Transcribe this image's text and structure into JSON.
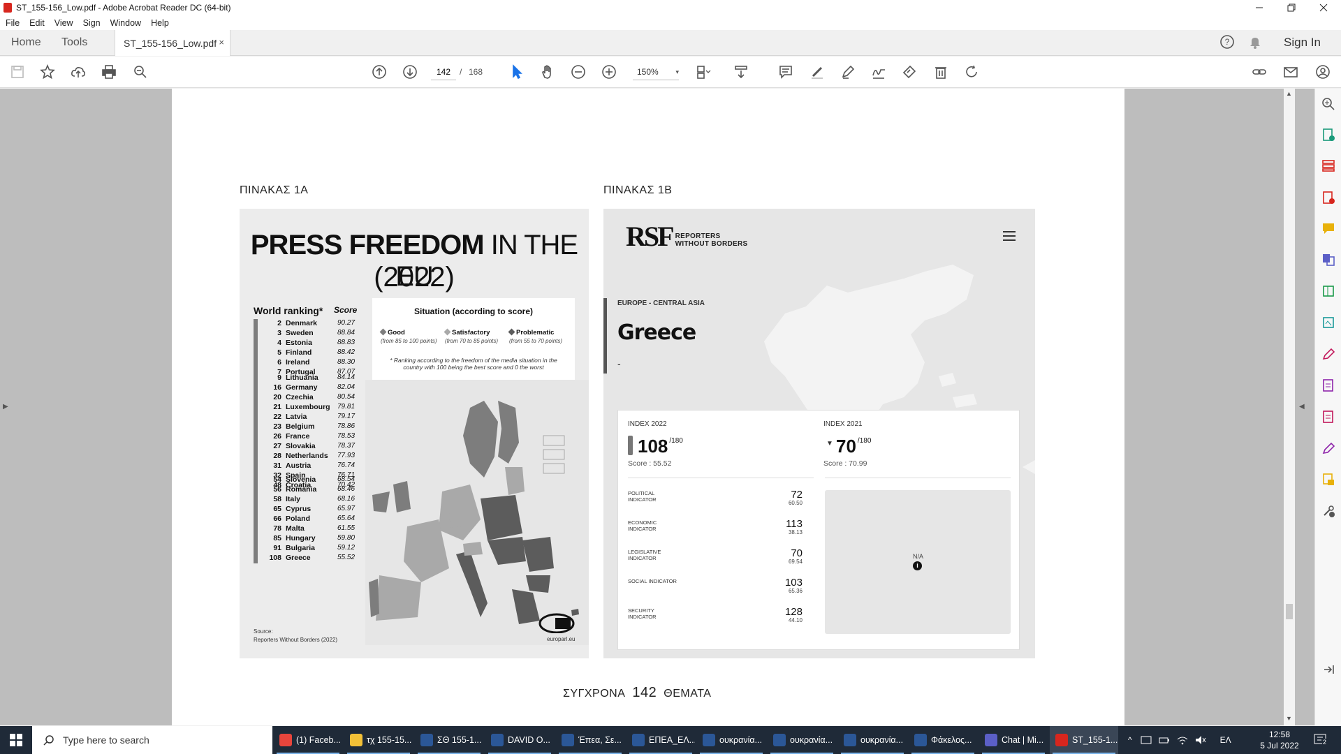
{
  "window": {
    "title": "ST_155-156_Low.pdf - Adobe Acrobat Reader DC (64-bit)",
    "minimize_icon": "minimize-icon",
    "restore_icon": "restore-icon",
    "close_icon": "close-icon"
  },
  "menu": [
    "File",
    "Edit",
    "View",
    "Sign",
    "Window",
    "Help"
  ],
  "tabs": {
    "home": "Home",
    "tools": "Tools",
    "doc": "ST_155-156_Low.pdf",
    "doc_close": "×",
    "signin": "Sign In"
  },
  "toolbar": {
    "page_current": "142",
    "page_sep": "/",
    "page_total": "168",
    "zoom": "150%",
    "zoom_chevron": "▾"
  },
  "document": {
    "label_a": "ΠΙΝΑΚΑΣ 1Α",
    "label_b": "ΠΙΝΑΚΑΣ 1Β",
    "footer_left": "ΣΥΓΧΡΟΝΑ",
    "footer_page": "142",
    "footer_right": "ΘΕΜΑΤΑ",
    "infographic_a": {
      "title_bold": "PRESS FREEDOM",
      "title_rest": " IN THE EU",
      "title_year": "(2022)",
      "ranking_header": "World ranking*",
      "score_header": "Score",
      "situation_title": "Situation (according to score)",
      "legend": [
        {
          "label": "Good",
          "range": "(from 85 to 100 points)",
          "color": "#7d7d7d"
        },
        {
          "label": "Satisfactory",
          "range": "(from 70 to 85 points)",
          "color": "#a9a9a9"
        },
        {
          "label": "Problematic",
          "range": "(from 55 to 70 points)",
          "color": "#5c5c5c"
        }
      ],
      "note": "* Ranking according to the freedom of the media situation in the country with 100 being the best score and 0 the worst",
      "groups": [
        {
          "name": "Good",
          "rows": [
            {
              "rank": "2",
              "country": "Denmark",
              "score": "90.27"
            },
            {
              "rank": "3",
              "country": "Sweden",
              "score": "88.84"
            },
            {
              "rank": "4",
              "country": "Estonia",
              "score": "88.83"
            },
            {
              "rank": "5",
              "country": "Finland",
              "score": "88.42"
            },
            {
              "rank": "6",
              "country": "Ireland",
              "score": "88.30"
            },
            {
              "rank": "7",
              "country": "Portugal",
              "score": "87.07"
            }
          ]
        },
        {
          "name": "Satisfactory",
          "rows": [
            {
              "rank": "9",
              "country": "Lithuania",
              "score": "84.14"
            },
            {
              "rank": "16",
              "country": "Germany",
              "score": "82.04"
            },
            {
              "rank": "20",
              "country": "Czechia",
              "score": "80.54"
            },
            {
              "rank": "21",
              "country": "Luxembourg",
              "score": "79.81"
            },
            {
              "rank": "22",
              "country": "Latvia",
              "score": "79.17"
            },
            {
              "rank": "23",
              "country": "Belgium",
              "score": "78.86"
            },
            {
              "rank": "26",
              "country": "France",
              "score": "78.53"
            },
            {
              "rank": "27",
              "country": "Slovakia",
              "score": "78.37"
            },
            {
              "rank": "28",
              "country": "Netherlands",
              "score": "77.93"
            },
            {
              "rank": "31",
              "country": "Austria",
              "score": "76.74"
            },
            {
              "rank": "32",
              "country": "Spain",
              "score": "76.71"
            },
            {
              "rank": "48",
              "country": "Croatia",
              "score": "70.42"
            }
          ]
        },
        {
          "name": "Problematic",
          "rows": [
            {
              "rank": "54",
              "country": "Slovenia",
              "score": "68.54"
            },
            {
              "rank": "56",
              "country": "Romania",
              "score": "68.46"
            },
            {
              "rank": "58",
              "country": "Italy",
              "score": "68.16"
            },
            {
              "rank": "65",
              "country": "Cyprus",
              "score": "65.97"
            },
            {
              "rank": "66",
              "country": "Poland",
              "score": "65.64"
            },
            {
              "rank": "78",
              "country": "Malta",
              "score": "61.55"
            },
            {
              "rank": "85",
              "country": "Hungary",
              "score": "59.80"
            },
            {
              "rank": "91",
              "country": "Bulgaria",
              "score": "59.12"
            },
            {
              "rank": "108",
              "country": "Greece",
              "score": "55.52"
            }
          ]
        }
      ],
      "source_label": "Source:",
      "source": "Reporters Without Borders (2022)",
      "credit": "europarl.eu"
    },
    "infographic_b": {
      "logo": "RSF",
      "logo_sub_1": "REPORTERS",
      "logo_sub_2": "WITHOUT BORDERS",
      "region": "EUROPE - CENTRAL ASIA",
      "country": "Greece",
      "dash": "-",
      "index_2022_label": "INDEX 2022",
      "index_2022": "108",
      "index_2022_of": "/180",
      "score_2022": "Score : 55.52",
      "index_2021_label": "INDEX 2021",
      "index_2021_arrow": "▼",
      "index_2021": "70",
      "index_2021_of": "/180",
      "score_2021": "Score : 70.99",
      "indicators": [
        {
          "label": "POLITICAL INDICATOR",
          "rank": "72",
          "score": "60.50"
        },
        {
          "label": "ECONOMIC INDICATOR",
          "rank": "113",
          "score": "38.13"
        },
        {
          "label": "LEGISLATIVE INDICATOR",
          "rank": "70",
          "score": "69.54"
        },
        {
          "label": "SOCIAL INDICATOR",
          "rank": "103",
          "score": "65.36"
        },
        {
          "label": "SECURITY INDICATOR",
          "rank": "128",
          "score": "44.10"
        }
      ],
      "map_na": "N/A",
      "map_info": "i"
    }
  },
  "taskbar": {
    "search_placeholder": "Type here to search",
    "apps": [
      {
        "label": "(1) Faceb...",
        "icon": "chrome-icon",
        "color": "#e8453c"
      },
      {
        "label": "τχ 155-15...",
        "icon": "folder-icon",
        "color": "#f2c037"
      },
      {
        "label": "ΣΘ 155-1...",
        "icon": "word-icon",
        "color": "#2b5797"
      },
      {
        "label": "DAVID O...",
        "icon": "word-icon",
        "color": "#2b5797"
      },
      {
        "label": "Έπεα, Σε...",
        "icon": "word-icon",
        "color": "#2b5797"
      },
      {
        "label": "ΕΠΕΑ_ΕΛ...",
        "icon": "word-icon",
        "color": "#2b5797"
      },
      {
        "label": "ουκρανία...",
        "icon": "word-icon",
        "color": "#2b5797"
      },
      {
        "label": "ουκρανία...",
        "icon": "word-icon",
        "color": "#2b5797"
      },
      {
        "label": "ουκρανία...",
        "icon": "word-icon",
        "color": "#2b5797"
      },
      {
        "label": "Φάκελος...",
        "icon": "word-icon",
        "color": "#2b5797"
      },
      {
        "label": "Chat | Mi...",
        "icon": "teams-icon",
        "color": "#5b5fc7"
      },
      {
        "label": "ST_155-1...",
        "icon": "acrobat-icon",
        "color": "#d7261e"
      }
    ],
    "lang": "ΕΛ",
    "time": "12:58",
    "date": "5 Jul 2022",
    "notif_count": "2"
  }
}
